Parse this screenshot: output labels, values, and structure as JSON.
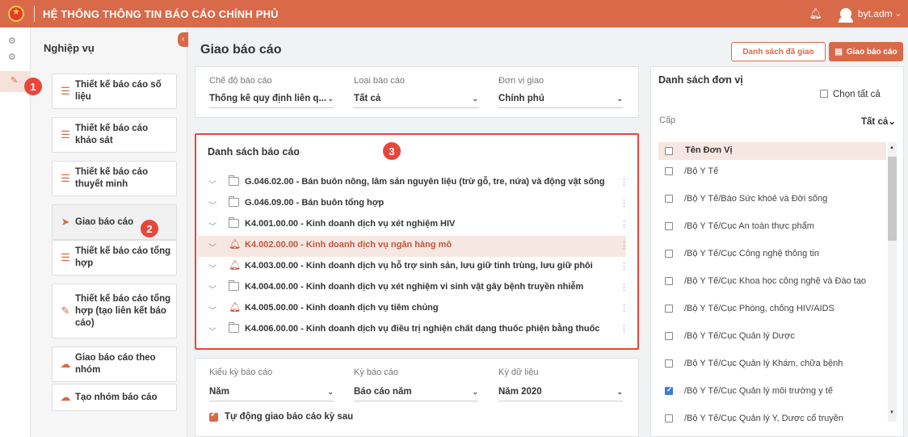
{
  "header": {
    "title": "HỆ THỐNG THÔNG TIN BÁO CÁO CHÍNH PHỦ",
    "username": "byt.adm"
  },
  "markers": [
    "1",
    "2",
    "3"
  ],
  "sidebar": {
    "title": "Nghiệp vụ",
    "items": [
      {
        "label": "Thiết kế báo cáo số liệu",
        "icon": "list-icon"
      },
      {
        "label": "Thiết kế báo cáo khảo sát",
        "icon": "list-icon"
      },
      {
        "label": "Thiết kế báo cáo thuyết minh",
        "icon": "list-icon"
      },
      {
        "label": "Giao báo cáo",
        "icon": "send-icon"
      },
      {
        "label": "Thiết kế báo cáo tổng hợp",
        "icon": "list-icon"
      },
      {
        "label": "Thiết kế báo cáo tổng hợp (tạo liên kết báo cáo)",
        "icon": "pencil-icon"
      },
      {
        "label": "Giao báo cáo theo nhóm",
        "icon": "group-icon"
      },
      {
        "label": "Tạo nhóm báo cáo",
        "icon": "group-icon"
      }
    ]
  },
  "main": {
    "title": "Giao báo cáo",
    "buttons": {
      "assigned_list": "Danh sách đã giao",
      "assign": "Giao báo cáo"
    },
    "filters": {
      "mode_label": "Chế độ báo cáo",
      "mode_value": "Thống kê quy định liên q...",
      "type_label": "Loại báo cáo",
      "type_value": "Tất cả",
      "unit_label": "Đơn vị giao",
      "unit_value": "Chính phủ"
    },
    "report_list": {
      "title": "Danh sách báo cáo",
      "items": [
        {
          "label": "G.046.02.00 - Bán buôn nông, lâm sản nguyên liệu (trừ gỗ, tre, nứa) và động vật sống",
          "icon": "folder-icon"
        },
        {
          "label": "G.046.09.00 - Bán buôn tổng hợp",
          "icon": "folder-icon"
        },
        {
          "label": "K4.001.00.00 - Kinh doanh dịch vụ xét nghiệm HIV",
          "icon": "folder-icon"
        },
        {
          "label": "K4.002.00.00 - Kinh doanh dịch vụ ngân hàng mô",
          "icon": "bell-icon"
        },
        {
          "label": "K4.003.00.00 - Kinh doanh dịch vụ hỗ trợ sinh sản, lưu giữ tinh trùng, lưu giữ phôi",
          "icon": "bell-icon"
        },
        {
          "label": "K4.004.00.00 - Kinh doanh dịch vụ xét nghiệm vi sinh vật gây bệnh truyền nhiễm",
          "icon": "folder-icon"
        },
        {
          "label": "K4.005.00.00 - Kinh doanh dịch vụ tiêm chủng",
          "icon": "bell-icon"
        },
        {
          "label": "K4.006.00.00 - Kinh doanh dịch vụ điều trị nghiện chất dạng thuốc phiện bằng thuốc",
          "icon": "folder-icon"
        }
      ]
    },
    "period": {
      "kind_label": "Kiểu kỳ báo cáo",
      "kind_value": "Năm",
      "period_label": "Kỳ báo cáo",
      "period_value": "Báo cáo năm",
      "data_label": "Kỳ dữ liệu",
      "data_value": "Năm 2020",
      "auto_label": "Tự động giao báo cáo kỳ sau"
    }
  },
  "units": {
    "title": "Danh sách đơn vị",
    "select_all": "Chọn tất cả",
    "level_label": "Cấp",
    "level_value": "Tất cả",
    "column_header": "Tên Đơn Vị",
    "rows": [
      {
        "name": "/Bộ Y Tế",
        "checked": false
      },
      {
        "name": "/Bộ Y Tế/Báo Sức khoẻ và Đời sống",
        "checked": false
      },
      {
        "name": "/Bộ Y Tế/Cục An toàn thực phẩm",
        "checked": false
      },
      {
        "name": "/Bộ Y Tế/Cục Công nghệ thông tin",
        "checked": false
      },
      {
        "name": "/Bộ Y Tế/Cục Khoa học công nghệ và Đào tạo",
        "checked": false
      },
      {
        "name": "/Bộ Y Tế/Cục Phòng, chống HIV/AIDS",
        "checked": false
      },
      {
        "name": "/Bộ Y Tế/Cục Quản lý Dược",
        "checked": false
      },
      {
        "name": "/Bộ Y Tế/Cục Quản lý Khám, chữa bệnh",
        "checked": false
      },
      {
        "name": "/Bộ Y Tế/Cục Quản lý môi trường y tế",
        "checked": true
      },
      {
        "name": "/Bộ Y Tế/Cục Quản lý Y, Dược cổ truyền",
        "checked": false
      }
    ]
  },
  "colors": {
    "brand": "#d86a4a",
    "marker": "#e8463a",
    "highlight": "#f7e7e2",
    "check": "#3b7be0"
  }
}
